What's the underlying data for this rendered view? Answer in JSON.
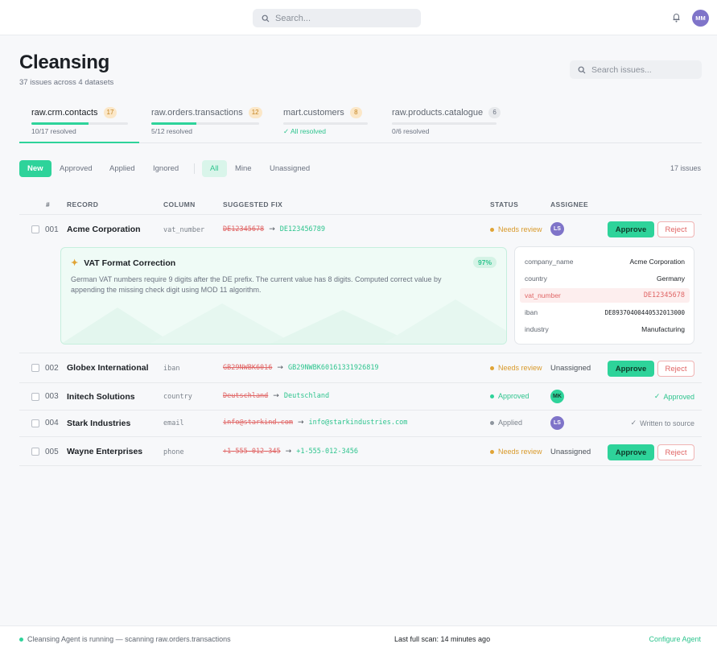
{
  "topbar": {
    "search_placeholder": "Search...",
    "user_initials": "MM",
    "icons": [
      "search-icon",
      "bell-icon"
    ]
  },
  "header": {
    "title": "Cleansing",
    "subtitle": "37 issues across 4 datasets",
    "search_placeholder": "Search issues..."
  },
  "datasets": [
    {
      "name": "raw.crm.contacts",
      "count": "17",
      "status": "10/17 resolved",
      "progress": 0.59,
      "active": true
    },
    {
      "name": "raw.orders.transactions",
      "count": "12",
      "status": "5/12 resolved",
      "progress": 0.42,
      "active": false
    },
    {
      "name": "mart.customers",
      "count": "8",
      "status": "All resolved",
      "progress": 0,
      "active": false
    },
    {
      "name": "raw.products.catalogue",
      "count": "6",
      "status": "0/6 resolved",
      "progress": 0,
      "active": false
    }
  ],
  "filters": {
    "status": [
      "New",
      "Approved",
      "Applied",
      "Ignored"
    ],
    "owner": [
      "All",
      "Mine",
      "Unassigned"
    ],
    "count": "17 issues"
  },
  "table": {
    "headers": [
      "#",
      "RECORD",
      "COLUMN",
      "SUGGESTED FIX",
      "STATUS",
      "ASSIGNEE"
    ],
    "rows": [
      {
        "num": "001",
        "record": "Acme Corporation",
        "column": "vat_number",
        "old": "DE12345678",
        "new": "DE123456789",
        "status": "Needs review",
        "assignee": "LS",
        "approve": "Approve",
        "reject": "Reject"
      },
      {
        "num": "002",
        "record": "Globex International",
        "column": "iban",
        "old": "GB29NWBK6016",
        "new": "GB29NWBK60161331926819",
        "status": "Needs review",
        "assignee": "Unassigned",
        "approve": "Approve",
        "reject": "Reject"
      },
      {
        "num": "003",
        "record": "Initech Solutions",
        "column": "country",
        "old": "Deutschland",
        "new": "Deutschland",
        "status": "Approved",
        "assignee": "MK",
        "done": "Approved"
      },
      {
        "num": "004",
        "record": "Stark Industries",
        "column": "email",
        "old": "info@starkind.com",
        "new": "info@starkindustries.com",
        "status": "Applied",
        "assignee": "LS",
        "done": "Written to source"
      },
      {
        "num": "005",
        "record": "Wayne Enterprises",
        "column": "phone",
        "old": "+1-555-012-345",
        "new": "+1-555-012-3456",
        "status": "Needs review",
        "assignee": "Unassigned",
        "approve": "Approve",
        "reject": "Reject"
      }
    ]
  },
  "suggestion": {
    "title": "VAT Format Correction",
    "confidence": "97%",
    "description": "German VAT numbers require 9 digits after the DE prefix. The current value has 8 digits. Computed correct value by appending the missing check digit using MOD 11 algorithm."
  },
  "record_details": [
    {
      "key": "company_name",
      "value": "Acme Corporation"
    },
    {
      "key": "country",
      "value": "Germany"
    },
    {
      "key": "vat_number",
      "value": "DE12345678"
    },
    {
      "key": "iban",
      "value": "DE89370400440532013000"
    },
    {
      "key": "industry",
      "value": "Manufacturing"
    }
  ],
  "footer": {
    "agent_status": "Cleansing Agent is running — scanning raw.orders.transactions",
    "last_scan": "Last full scan: 14 minutes ago",
    "configure": "Configure Agent"
  },
  "colors": {
    "accent": "#2ed39a",
    "warning": "#e0a436",
    "danger": "#e06565",
    "avatar": "#7f74c9"
  }
}
